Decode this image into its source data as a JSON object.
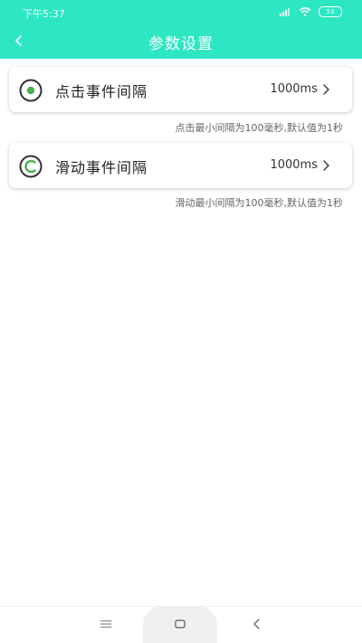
{
  "status_bar": {
    "time": "下午5:37",
    "battery": "53"
  },
  "header": {
    "title": "参数设置"
  },
  "settings": [
    {
      "label": "点击事件间隔",
      "value": "1000ms",
      "hint": "点击最小间隔为100毫秒,默认值为1秒",
      "icon": "click-icon"
    },
    {
      "label": "滑动事件间隔",
      "value": "1000ms",
      "hint": "滑动最小间隔为100毫秒,默认值为1秒",
      "icon": "swipe-icon"
    }
  ],
  "colors": {
    "accent": "#2de7c3",
    "icon_green": "#4caf50",
    "icon_ring": "#333333"
  }
}
